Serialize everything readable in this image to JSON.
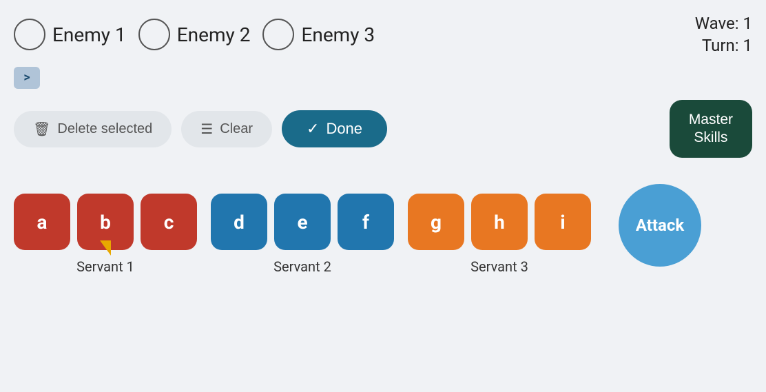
{
  "header": {
    "enemies": [
      {
        "id": "enemy-1",
        "label": "Enemy 1"
      },
      {
        "id": "enemy-2",
        "label": "Enemy 2"
      },
      {
        "id": "enemy-3",
        "label": "Enemy 3"
      }
    ],
    "wave_label": "Wave: 1",
    "turn_label": "Turn: 1"
  },
  "arrow_btn": {
    "icon": ">"
  },
  "actions": {
    "delete_label": "Delete selected",
    "clear_label": "Clear",
    "done_label": "Done",
    "master_label": "Master\nSkills"
  },
  "servants": [
    {
      "name": "Servant 1",
      "color": "red",
      "cards": [
        {
          "key": "a",
          "has_pointer": false
        },
        {
          "key": "b",
          "has_pointer": true
        },
        {
          "key": "c",
          "has_pointer": false
        }
      ]
    },
    {
      "name": "Servant 2",
      "color": "blue",
      "cards": [
        {
          "key": "d",
          "has_pointer": false
        },
        {
          "key": "e",
          "has_pointer": false
        },
        {
          "key": "f",
          "has_pointer": false
        }
      ]
    },
    {
      "name": "Servant 3",
      "color": "orange",
      "cards": [
        {
          "key": "g",
          "has_pointer": false
        },
        {
          "key": "h",
          "has_pointer": false
        },
        {
          "key": "i",
          "has_pointer": false
        }
      ]
    }
  ],
  "attack_btn": {
    "label": "Attack"
  }
}
